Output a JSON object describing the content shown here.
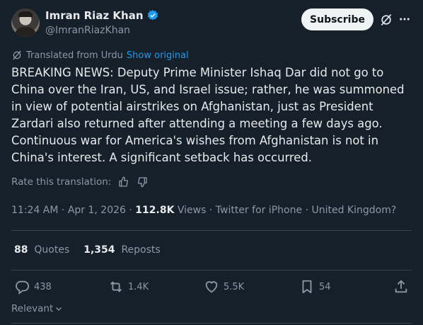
{
  "author": {
    "name": "Imran Riaz Khan",
    "handle": "@ImranRiazKhan"
  },
  "subscribe_label": "Subscribe",
  "translation": {
    "note": "Translated from Urdu",
    "show_original": "Show original",
    "rate_label": "Rate this translation:"
  },
  "tweet_text": "BREAKING NEWS: Deputy Prime Minister Ishaq Dar did not go to China over the Iran, US, and Israel issue; rather, he was summoned in view of potential airstrikes on Afghanistan, just as President Zardari also returned after attending a meeting a few days ago. Continuous war for America's wishes from Afghanistan is not in China's interest. A significant setback has occurred.",
  "meta": {
    "time": "11:24 AM",
    "date": "Apr 1, 2026",
    "views_count": "112.8K",
    "views_label": "Views",
    "source": "Twitter for iPhone",
    "location": "United Kingdom?",
    "sep": "·"
  },
  "stats": {
    "quotes_count": "88",
    "quotes_label": "Quotes",
    "reposts_count": "1,354",
    "reposts_label": "Reposts"
  },
  "actions": {
    "replies": "438",
    "reposts": "1.4K",
    "likes": "5.5K",
    "bookmarks": "54"
  },
  "sort_label": "Relevant",
  "colors": {
    "background": "#15202b",
    "text": "#e7e9ea",
    "secondary": "#8b98a5",
    "accent": "#1d9bf0",
    "divider": "#38444d"
  },
  "icons": [
    "verified-badge-icon",
    "grok-icon",
    "more-icon",
    "translate-icon",
    "thumbs-up-icon",
    "thumbs-down-icon",
    "reply-icon",
    "repost-icon",
    "like-icon",
    "bookmark-icon",
    "share-icon",
    "chevron-down-icon"
  ]
}
